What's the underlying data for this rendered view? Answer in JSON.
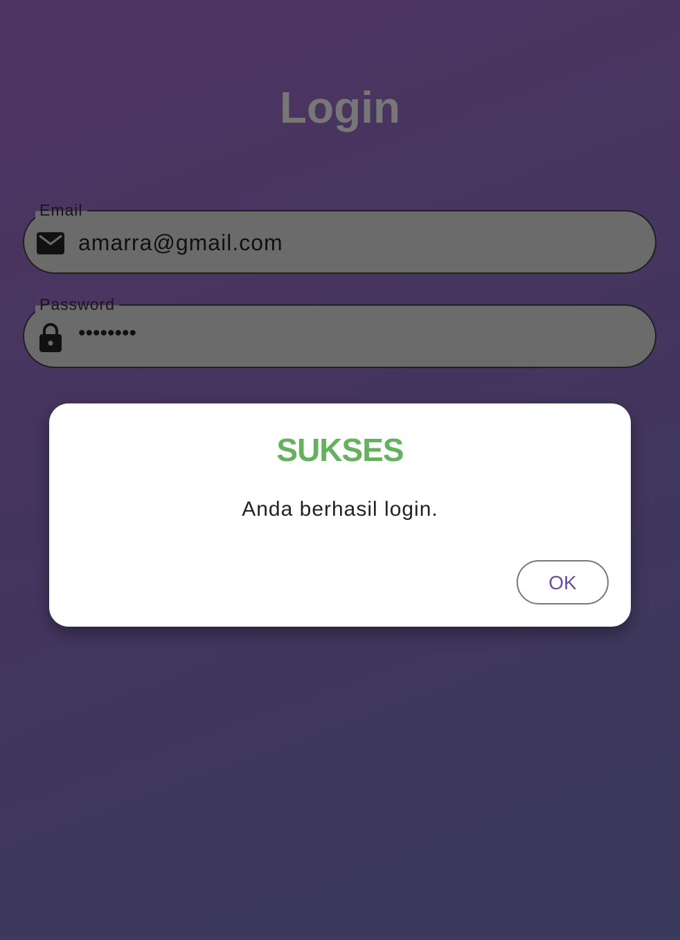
{
  "page": {
    "title": "Login",
    "colors": {
      "background_gradient": [
        "#8e5fb3",
        "#6b6aa8"
      ],
      "field_fill": "#c4c4c4",
      "success_green": "#66b160",
      "button_text": "#6a4ca6"
    }
  },
  "form": {
    "email": {
      "label": "Email",
      "value": "amarra@gmail.com",
      "icon": "email-envelope-icon"
    },
    "password": {
      "label": "Password",
      "value": "••••••••",
      "icon": "lock-icon"
    }
  },
  "dialog": {
    "title": "SUKSES",
    "message": "Anda berhasil login.",
    "ok_label": "OK"
  }
}
